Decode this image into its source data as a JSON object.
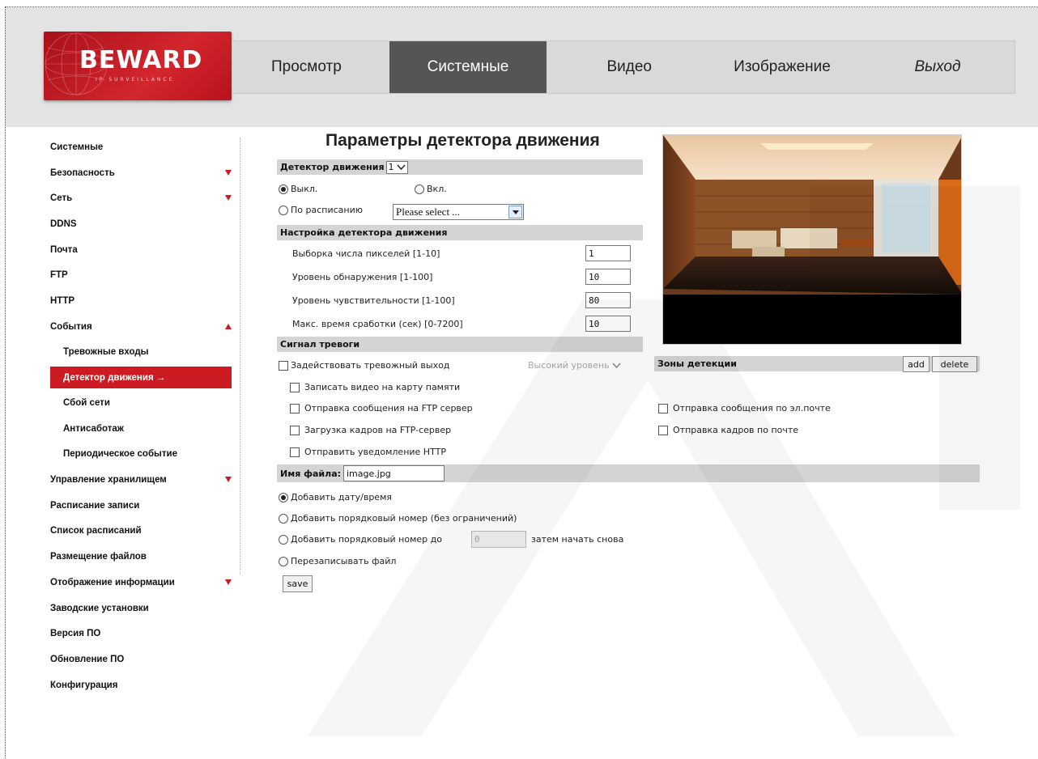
{
  "logo": {
    "brand": "BEWARD",
    "sub": "IP SURVEILLANCE"
  },
  "nav": {
    "items": [
      "Просмотр",
      "Системные",
      "Видео",
      "Изображение",
      "Выход"
    ]
  },
  "sidebar": {
    "items": [
      "Системные",
      "Безопасность",
      "Сеть",
      "DDNS",
      "Почта",
      "FTP",
      "HTTP",
      "События",
      "Тревожные входы",
      "Детектор движения",
      "Сбой сети",
      "Антисаботаж",
      "Периодическое событие",
      "Управление хранилищем",
      "Расписание записи",
      "Список расписаний",
      "Размещение файлов",
      "Отображение информации",
      "Заводские установки",
      "Версия ПО",
      "Обновление ПО",
      "Конфигурация"
    ],
    "selected_arrow": "→"
  },
  "main": {
    "title": "Параметры детектора движения",
    "detector_label": "Детектор движения",
    "detector_value": "1",
    "off_label": "Выкл.",
    "on_label": "Вкл.",
    "schedule_label": "По расписанию",
    "schedule_select": "Please select ...",
    "settings_header": "Настройка детектора движения",
    "settings": [
      {
        "label": "Выборка числа пикселей [1-10]",
        "value": "1"
      },
      {
        "label": "Уровень обнаружения [1-100]",
        "value": "10"
      },
      {
        "label": "Уровень чувствительности [1-100]",
        "value": "80"
      },
      {
        "label": "Макс. время сработки (сек) [0-7200]",
        "value": "10"
      }
    ],
    "alarm_header": "Сигнал тревоги",
    "alarm_output_label": "Задействовать тревожный выход",
    "alarm_level": "Высокий уровень",
    "zones_label": "Зоны детекции",
    "add_label": "add",
    "delete_label": "delete",
    "actions_left": [
      "Записать видео на карту памяти",
      "Отправка сообщения на FTP сервер",
      "Загрузка кадров на FTP-сервер",
      "Отправить уведомление HTTP"
    ],
    "actions_right": [
      "Отправка сообщения по эл.почте",
      "Отправка кадров по почте"
    ],
    "filename_label": "Имя файла:",
    "filename_value": "image.jpg",
    "naming": [
      "Добавить дату/время",
      "Добавить порядковый номер (без ограничений)",
      "Добавить порядковый номер до",
      "Перезаписывать файл"
    ],
    "counter_value": "0",
    "restart_label": "затем начать снова",
    "save_label": "save"
  },
  "colors": {
    "accent": "#cc1b22",
    "nav_active": "#555555",
    "header_bg": "#e3e3e3",
    "bar_bg": "#d4d4d4"
  }
}
